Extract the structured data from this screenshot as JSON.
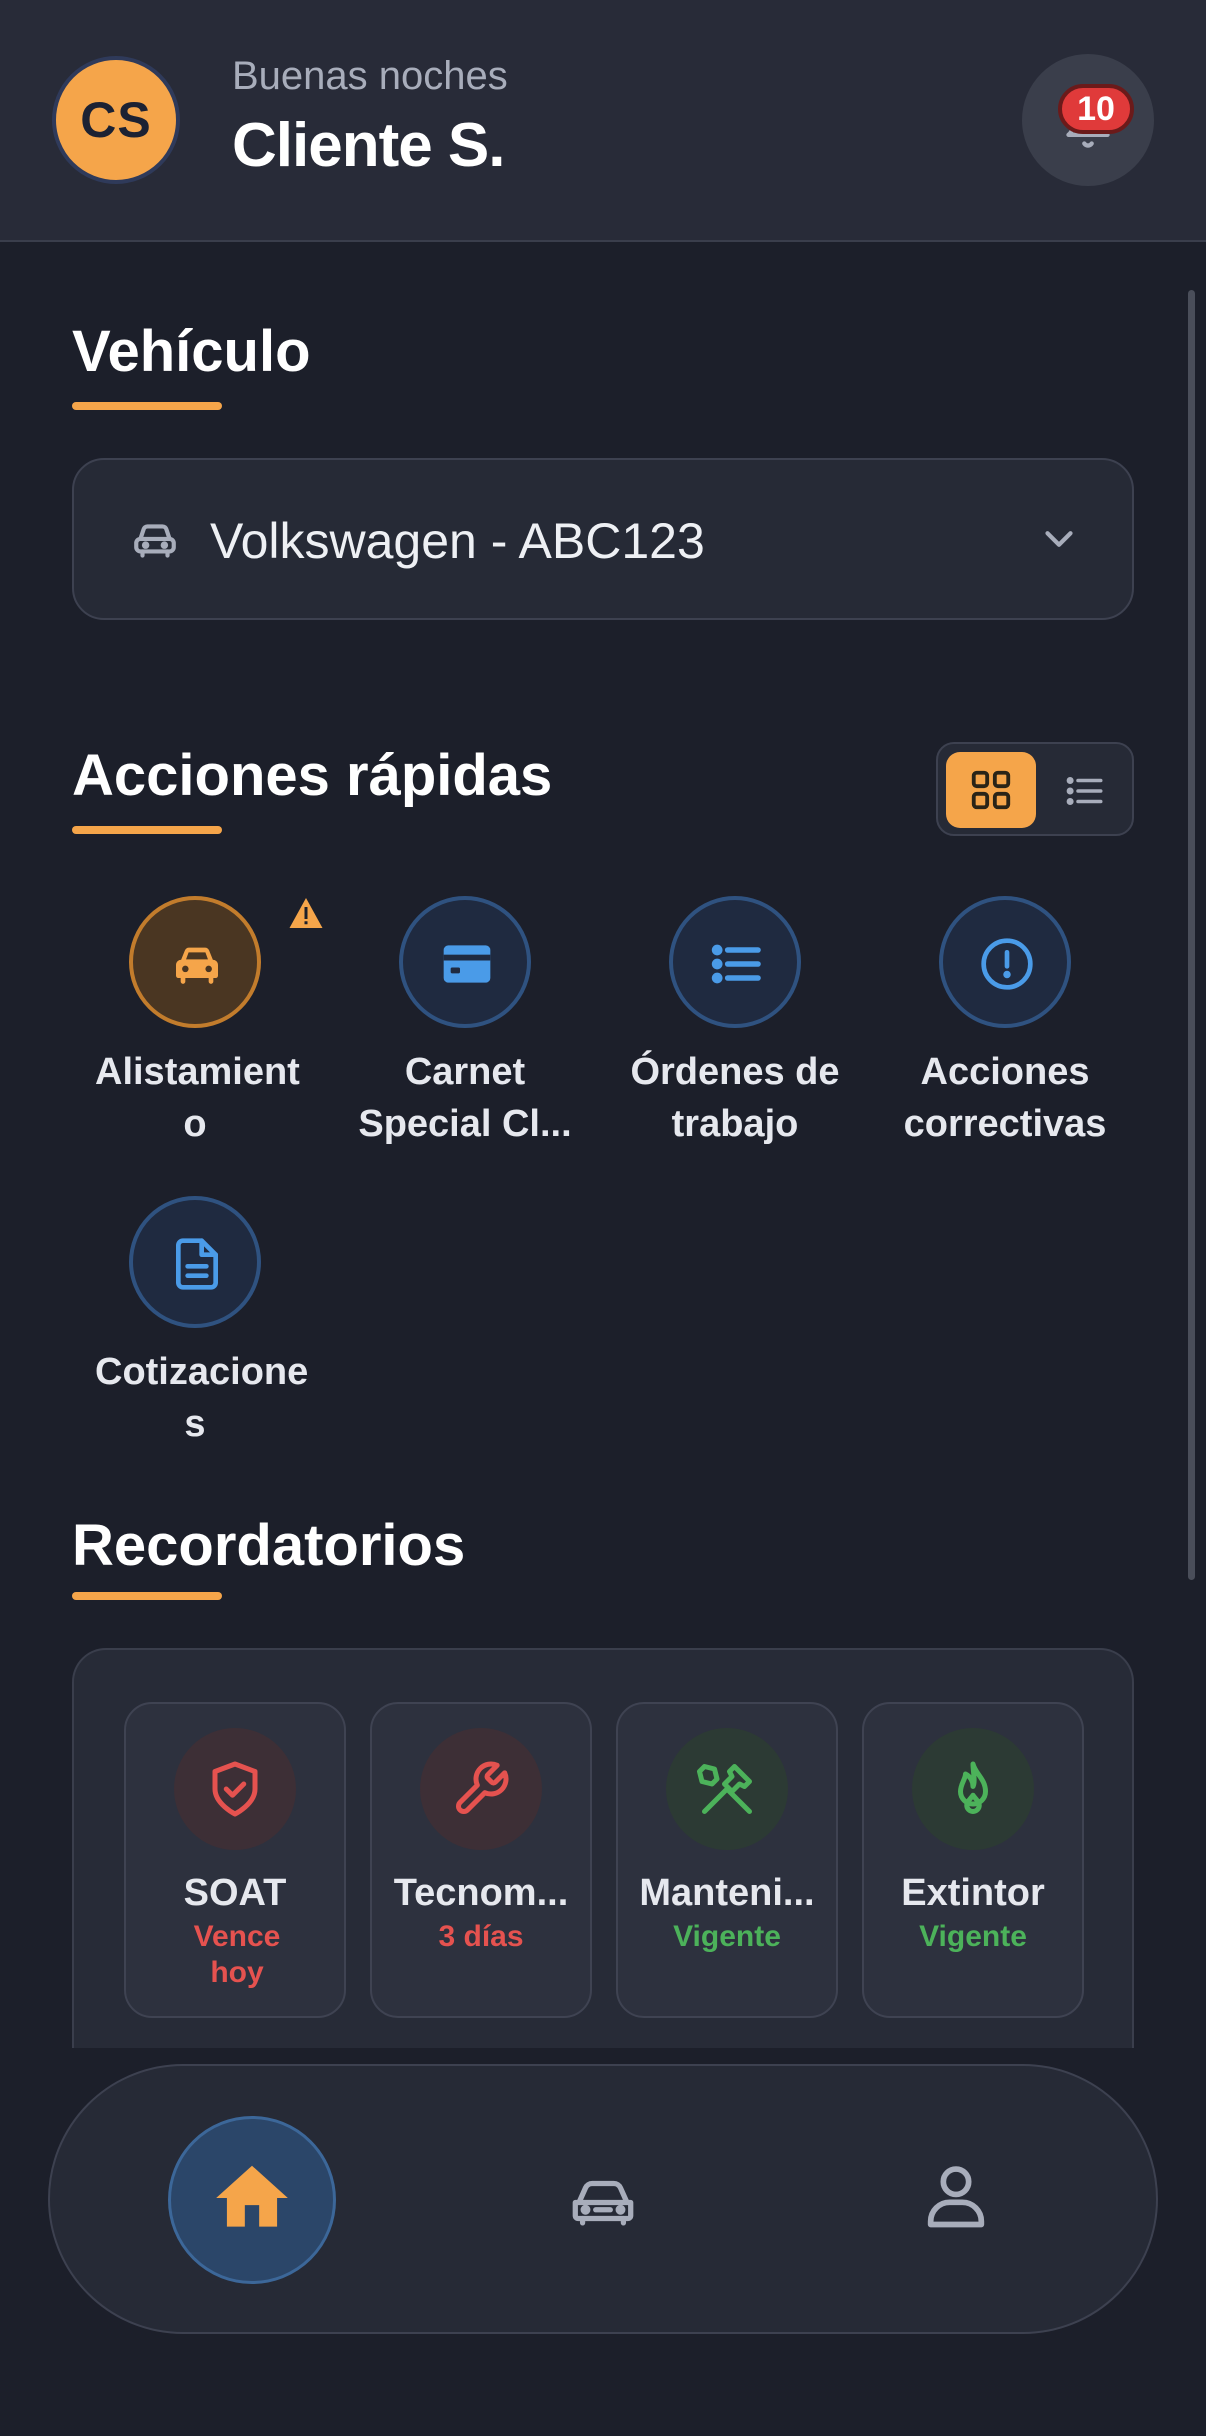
{
  "header": {
    "avatar_initials": "CS",
    "greeting": "Buenas noches",
    "username": "Cliente S.",
    "notification_count": "10"
  },
  "vehicle_section": {
    "title": "Vehículo",
    "selected_vehicle": "Volkswagen - ABC123"
  },
  "quick_actions": {
    "title": "Acciones rápidas",
    "view_mode": "grid",
    "items": [
      {
        "label": "Alistamient o",
        "icon": "car-icon",
        "color": "#f5a54a",
        "warning": true
      },
      {
        "label": "Carnet Special Cl...",
        "icon": "card-icon",
        "color": "#4a9be8"
      },
      {
        "label": "Órdenes de trabajo",
        "icon": "list-icon",
        "color": "#4a9be8"
      },
      {
        "label": "Acciones correctivas",
        "icon": "alert-circle-icon",
        "color": "#4a9be8"
      },
      {
        "label": "Cotizacione s",
        "icon": "document-icon",
        "color": "#4a9be8"
      }
    ]
  },
  "reminders": {
    "title": "Recordatorios",
    "items": [
      {
        "title": "SOAT",
        "status": "Vence hoy",
        "icon": "shield-check-icon",
        "tone": "red"
      },
      {
        "title": "Tecnom...",
        "status": "3 días",
        "icon": "wrench-icon",
        "tone": "red"
      },
      {
        "title": "Manteni...",
        "status": "Vigente",
        "icon": "tools-icon",
        "tone": "green"
      },
      {
        "title": "Extintor",
        "status": "Vigente",
        "icon": "flame-icon",
        "tone": "green"
      }
    ]
  },
  "bottom_nav": {
    "items": [
      {
        "icon": "home-icon",
        "active": true
      },
      {
        "icon": "car-icon",
        "active": false
      },
      {
        "icon": "user-icon",
        "active": false
      }
    ]
  },
  "colors": {
    "accent": "#f5a54a",
    "background": "#1c1f2a",
    "blue": "#4a9be8",
    "danger": "#e5524f",
    "success": "#4cb25a"
  }
}
